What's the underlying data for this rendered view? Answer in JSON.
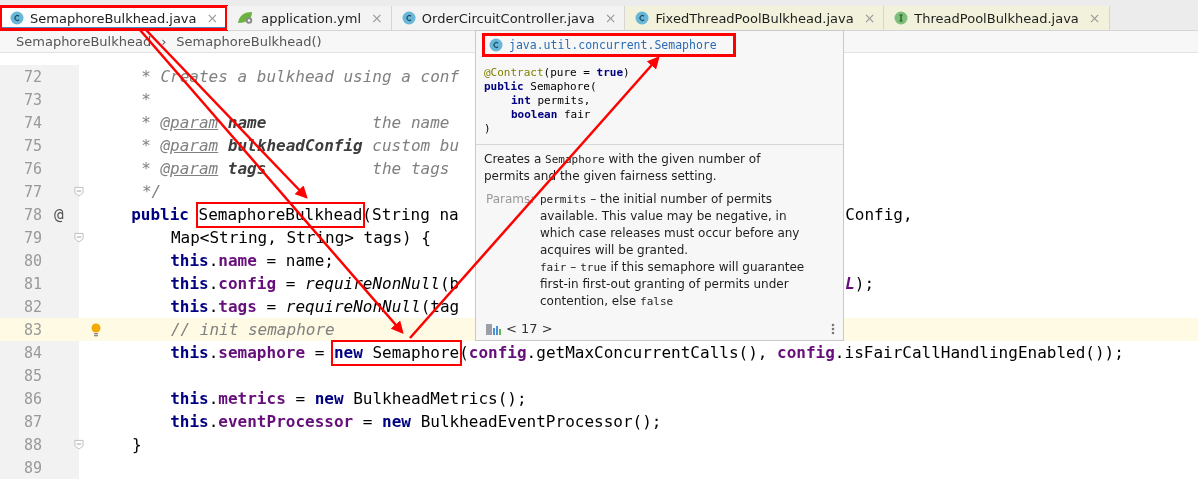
{
  "tabs": [
    {
      "label": "SemaphoreBulkhead.java",
      "kind": "class",
      "selected": true,
      "boxed": true,
      "color": "#ffffff",
      "close": "×"
    },
    {
      "label": "application.yml",
      "kind": "yaml",
      "selected": false,
      "boxed": false,
      "color": "#f3f3f3",
      "close": "×"
    },
    {
      "label": "OrderCircuitController.java",
      "kind": "class",
      "selected": false,
      "boxed": false,
      "color": "#f3f3f3",
      "close": "×"
    },
    {
      "label": "FixedThreadPoolBulkhead.java",
      "kind": "class",
      "selected": false,
      "boxed": false,
      "color": "#f2f1db",
      "close": "×"
    },
    {
      "label": "ThreadPoolBulkhead.java",
      "kind": "interface",
      "selected": false,
      "boxed": false,
      "color": "#f2f1db",
      "close": "×"
    }
  ],
  "breadcrumbs": [
    {
      "label": "SemaphoreBulkhead",
      "separator": "›"
    },
    {
      "label": "SemaphoreBulkhead()"
    }
  ],
  "lines": [
    {
      "number": "72",
      "kind": "doc",
      "tokens": [
        {
          "t": "* Creates a bulkhead using a conf",
          "kind": "comment"
        }
      ]
    },
    {
      "number": "73",
      "kind": "doc",
      "tokens": [
        {
          "t": "*",
          "kind": "comment"
        }
      ]
    },
    {
      "number": "74",
      "kind": "doc",
      "tokens": [
        {
          "t": "* ",
          "kind": "comment"
        },
        {
          "t": "@param",
          "kind": "doctag"
        },
        {
          "t": " name",
          "kind": "docparam"
        },
        {
          "t": "           the name",
          "kind": "comment"
        }
      ]
    },
    {
      "number": "75",
      "kind": "doc",
      "tokens": [
        {
          "t": "* ",
          "kind": "comment"
        },
        {
          "t": "@param",
          "kind": "doctag"
        },
        {
          "t": " bulkheadConfig",
          "kind": "docparam"
        },
        {
          "t": " custom bu",
          "kind": "comment"
        }
      ]
    },
    {
      "number": "76",
      "kind": "doc",
      "tokens": [
        {
          "t": "* ",
          "kind": "comment"
        },
        {
          "t": "@param",
          "kind": "doctag"
        },
        {
          "t": " tags",
          "kind": "docparam"
        },
        {
          "t": "           the tags",
          "kind": "comment"
        }
      ]
    },
    {
      "number": "77",
      "kind": "doc",
      "fold": true,
      "tokens": [
        {
          "t": "*/",
          "kind": "comment"
        }
      ]
    },
    {
      "number": "78",
      "kind": "decl",
      "gutter_mark": "@",
      "tokens": [
        {
          "t": "public ",
          "kind": "keyword"
        },
        {
          "t": "SemaphoreBulkhead",
          "kind": "plain",
          "boxed": true
        },
        {
          "t": "(String na",
          "kind": "plain"
        }
      ],
      "right_tokens": [
        {
          "t": "Config,",
          "kind": "plain"
        }
      ]
    },
    {
      "number": "79",
      "kind": "body",
      "fold": true,
      "tokens": [
        {
          "t": "Map<String, String> tags) {",
          "kind": "plain"
        }
      ]
    },
    {
      "number": "80",
      "kind": "body",
      "tokens": [
        {
          "t": "this",
          "kind": "keyword"
        },
        {
          "t": ".",
          "kind": "plain"
        },
        {
          "t": "name",
          "kind": "field"
        },
        {
          "t": " = name;",
          "kind": "plain"
        }
      ]
    },
    {
      "number": "81",
      "kind": "body",
      "tokens": [
        {
          "t": "this",
          "kind": "keyword"
        },
        {
          "t": ".",
          "kind": "plain"
        },
        {
          "t": "config",
          "kind": "field"
        },
        {
          "t": " = ",
          "kind": "plain"
        },
        {
          "t": "requireNonNull",
          "kind": "call"
        },
        {
          "t": "(b",
          "kind": "plain"
        }
      ],
      "right_tokens": [
        {
          "t": "L",
          "kind": "const"
        },
        {
          "t": ");",
          "kind": "plain"
        }
      ]
    },
    {
      "number": "82",
      "kind": "body",
      "tokens": [
        {
          "t": "this",
          "kind": "keyword"
        },
        {
          "t": ".",
          "kind": "plain"
        },
        {
          "t": "tags",
          "kind": "field"
        },
        {
          "t": " = ",
          "kind": "plain"
        },
        {
          "t": "requireNonNull",
          "kind": "call"
        },
        {
          "t": "(tag",
          "kind": "plain"
        }
      ]
    },
    {
      "number": "83",
      "kind": "body",
      "current": true,
      "bulb": true,
      "tokens": [
        {
          "t": "// init semaphore",
          "kind": "comment"
        }
      ]
    },
    {
      "number": "84",
      "kind": "body",
      "tokens": [
        {
          "t": "this",
          "kind": "keyword"
        },
        {
          "t": ".",
          "kind": "plain"
        },
        {
          "t": "semaphore",
          "kind": "field"
        },
        {
          "t": " = ",
          "kind": "plain"
        },
        {
          "t": "new",
          "kind": "keyword",
          "boxed": true
        },
        {
          "t": " Semaphore",
          "kind": "plain",
          "boxed": true
        },
        {
          "t": "(",
          "kind": "plain"
        },
        {
          "t": "config",
          "kind": "field"
        },
        {
          "t": ".getMaxConcurrentCalls(), ",
          "kind": "plain"
        },
        {
          "t": "config",
          "kind": "field"
        },
        {
          "t": ".isFairCallHandlingEnabled());",
          "kind": "plain"
        }
      ]
    },
    {
      "number": "85"
    },
    {
      "number": "86",
      "kind": "body",
      "tokens": [
        {
          "t": "this",
          "kind": "keyword"
        },
        {
          "t": ".",
          "kind": "plain"
        },
        {
          "t": "metrics",
          "kind": "field"
        },
        {
          "t": " = ",
          "kind": "plain"
        },
        {
          "t": "new",
          "kind": "keyword"
        },
        {
          "t": " BulkheadMetrics();",
          "kind": "plain"
        }
      ]
    },
    {
      "number": "87",
      "kind": "body",
      "tokens": [
        {
          "t": "this",
          "kind": "keyword"
        },
        {
          "t": ".",
          "kind": "plain"
        },
        {
          "t": "eventProcessor",
          "kind": "field"
        },
        {
          "t": " = ",
          "kind": "plain"
        },
        {
          "t": "new",
          "kind": "keyword"
        },
        {
          "t": " BulkheadEventProcessor();",
          "kind": "plain"
        }
      ]
    },
    {
      "number": "88",
      "kind": "decl",
      "fold": true,
      "tokens": [
        {
          "t": "}",
          "kind": "plain"
        }
      ]
    },
    {
      "number": "89"
    }
  ],
  "popup": {
    "title": "java.util.concurrent.Semaphore",
    "title_boxed": true,
    "signature": [
      {
        "kind": "top",
        "tokens": [
          {
            "t": "@Contract",
            "kind": "annotation"
          },
          {
            "t": "(pure = ",
            "kind": "plain"
          },
          {
            "t": "true",
            "kind": "keyword"
          },
          {
            "t": ")",
            "kind": "plain"
          }
        ]
      },
      {
        "kind": "top",
        "tokens": [
          {
            "t": "public",
            "kind": "keyword"
          },
          {
            "t": " Semaphore(",
            "kind": "plain"
          }
        ]
      },
      {
        "kind": "indented",
        "tokens": [
          {
            "t": "int",
            "kind": "keyword"
          },
          {
            "t": " permits,",
            "kind": "plain"
          }
        ]
      },
      {
        "kind": "indented",
        "tokens": [
          {
            "t": "boolean",
            "kind": "keyword"
          },
          {
            "t": " fair",
            "kind": "plain"
          }
        ]
      },
      {
        "kind": "top",
        "tokens": [
          {
            "t": ")",
            "kind": "plain"
          }
        ]
      }
    ],
    "description": [
      {
        "t": "Creates a ",
        "kind": "text"
      },
      {
        "t": "Semaphore",
        "kind": "code"
      },
      {
        "t": " with the given number of permits and the given fairness setting.",
        "kind": "text"
      }
    ],
    "params_label": "Params:",
    "params": [
      [
        {
          "t": "permits",
          "kind": "code"
        },
        {
          "t": " – the initial number of permits available. This value may be negative, in which case releases must occur before any acquires will be granted.",
          "kind": "text"
        }
      ],
      [
        {
          "t": "fair",
          "kind": "code"
        },
        {
          "t": " – ",
          "kind": "text"
        },
        {
          "t": "true",
          "kind": "code"
        },
        {
          "t": " if this semaphore will guarantee first-in first-out granting of permits under contention, else ",
          "kind": "text"
        },
        {
          "t": "false",
          "kind": "code"
        }
      ]
    ],
    "footer": "< 17 >"
  }
}
